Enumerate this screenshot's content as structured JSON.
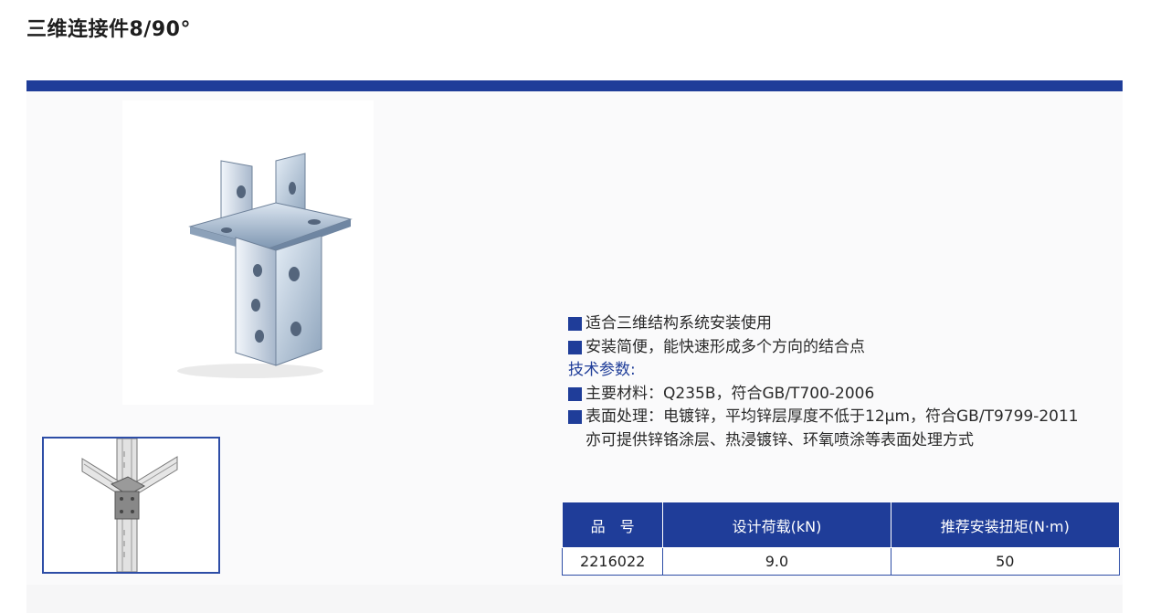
{
  "page": {
    "title": "三维连接件8/90°"
  },
  "features": [
    {
      "type": "bullet",
      "text": "适合三维结构系统安装使用"
    },
    {
      "type": "bullet",
      "text": "安装简便，能快速形成多个方向的结合点"
    },
    {
      "type": "heading",
      "text": "技术参数:"
    },
    {
      "type": "bullet",
      "text": "主要材料：Q235B，符合GB/T700-2006"
    },
    {
      "type": "bullet",
      "text": "表面处理：电镀锌，平均锌层厚度不低于12μm，符合GB/T9799-2011",
      "continuation": "亦可提供锌铬涂层、热浸镀锌、环氧喷涂等表面处理方式"
    }
  ],
  "spec_table": {
    "headers": [
      "品　号",
      "设计荷载(kN)",
      "推荐安装扭矩(N·m)"
    ],
    "rows": [
      [
        "2216022",
        "9.0",
        "50"
      ]
    ]
  },
  "colors": {
    "accent": "#1f3d99",
    "panel": "#fafafb"
  }
}
